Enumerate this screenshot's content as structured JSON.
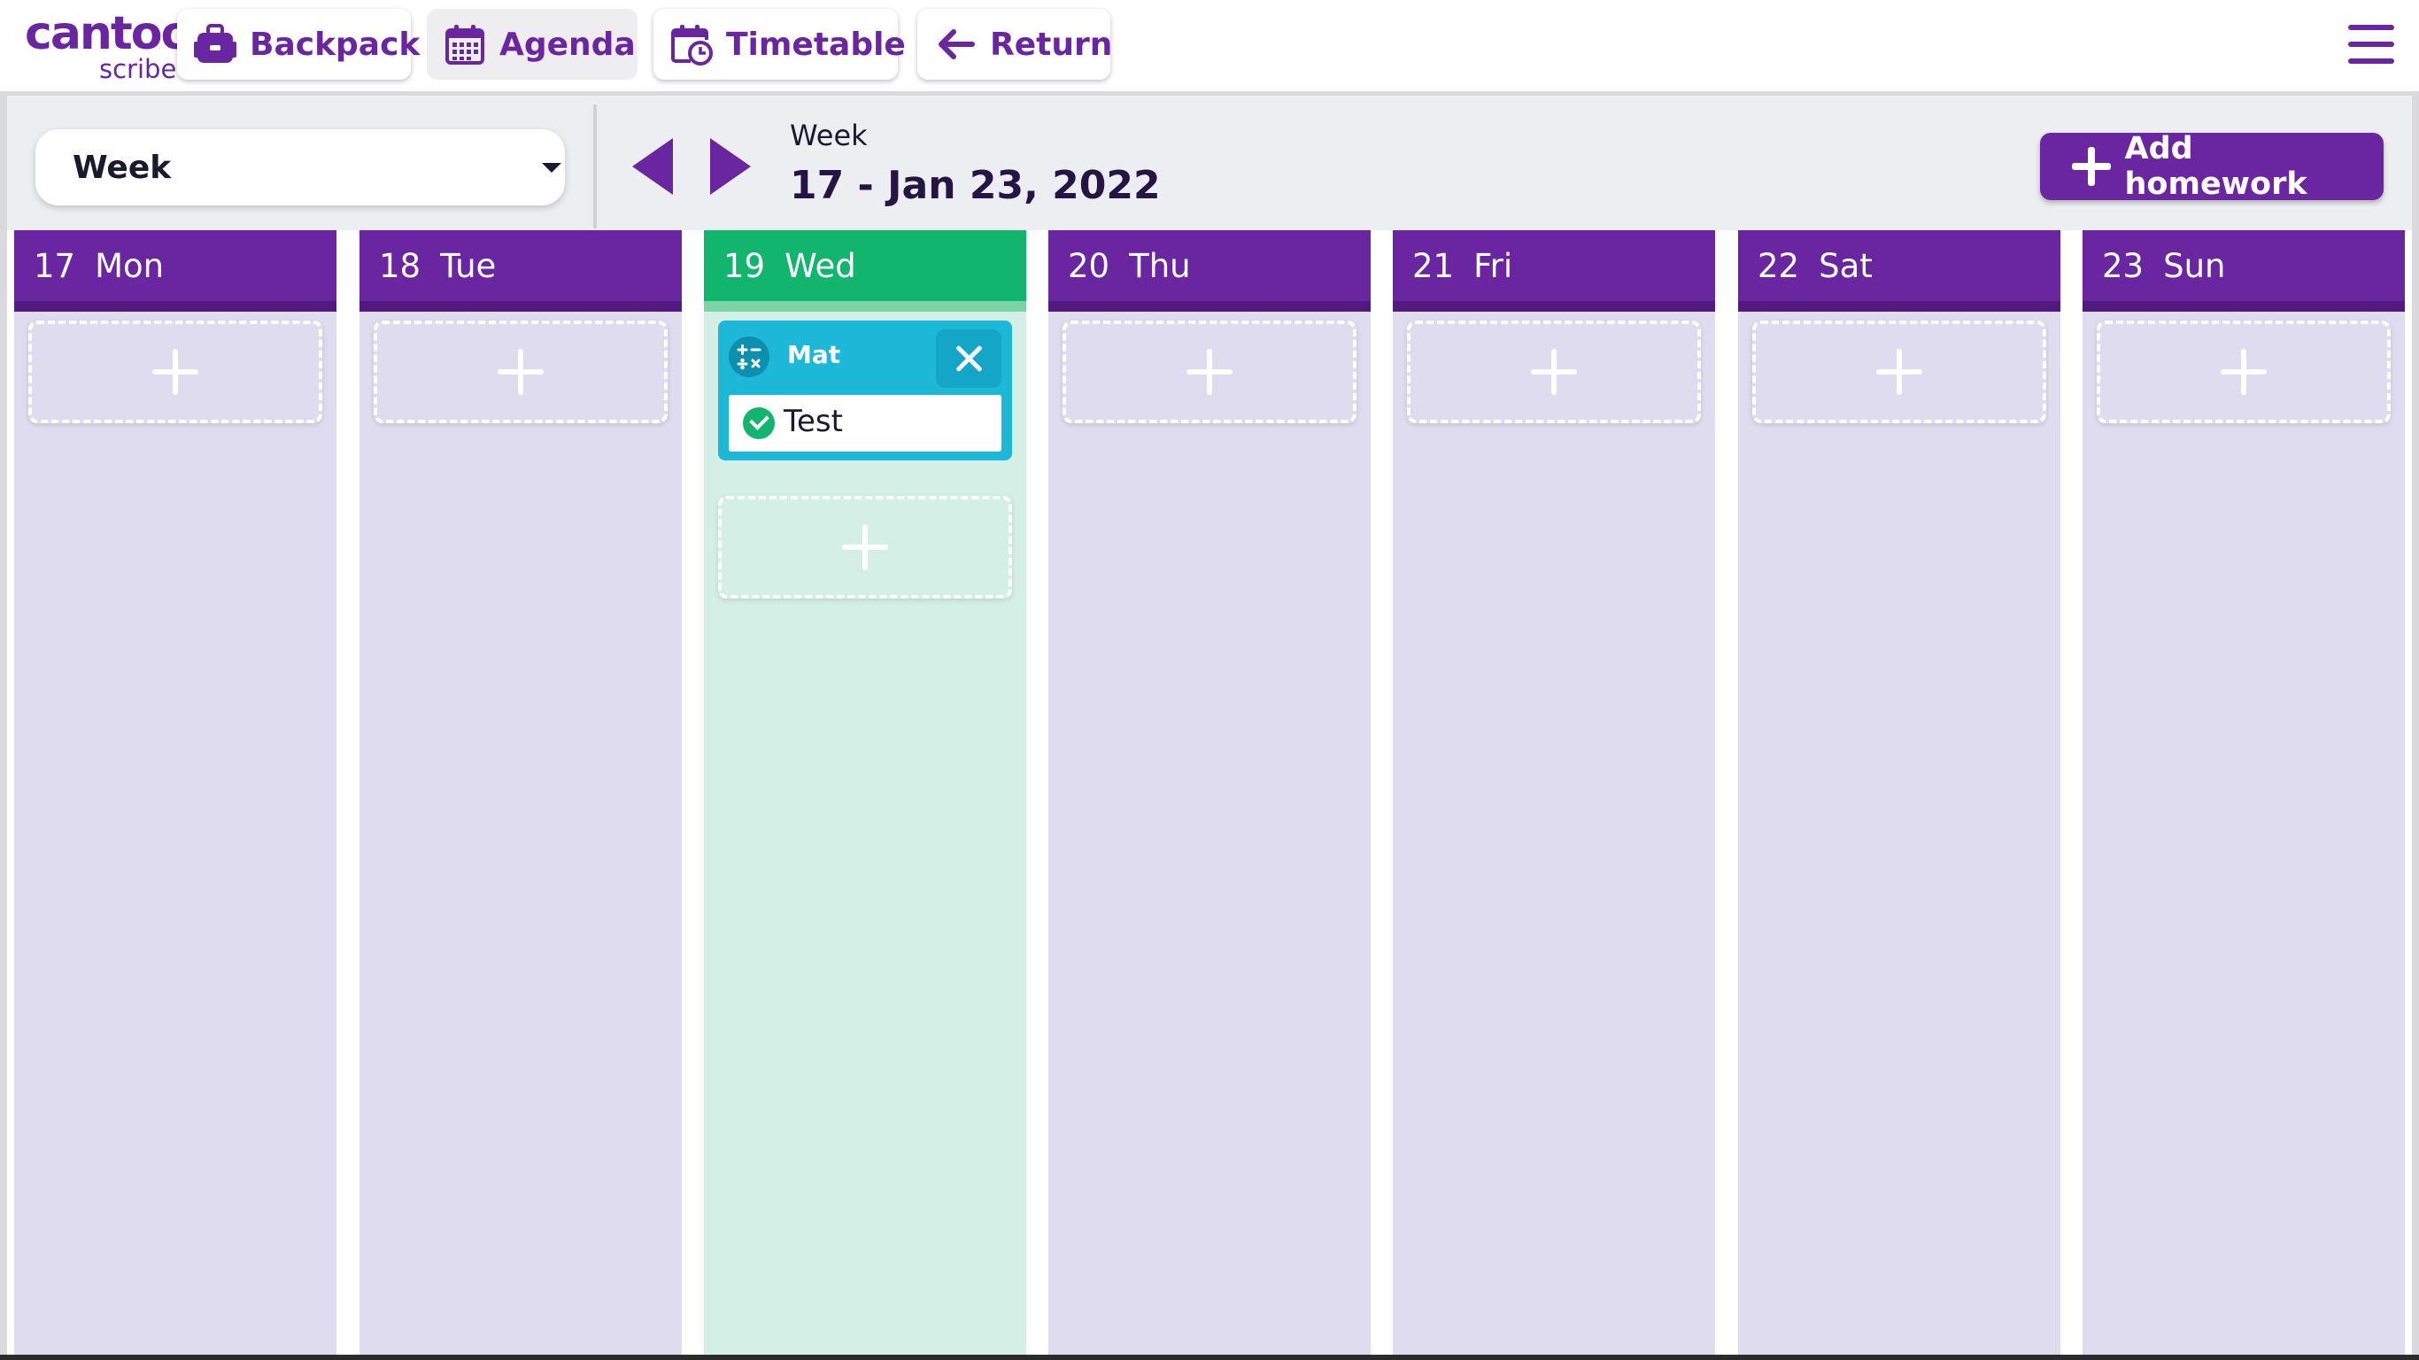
{
  "logo": {
    "main": "cantoo",
    "sub": "scribe"
  },
  "nav": {
    "backpack": "Backpack",
    "agenda": "Agenda",
    "timetable": "Timetable",
    "return": "Return"
  },
  "toolbar": {
    "view_select_value": "Week",
    "week_label": "Week",
    "week_range": "17 - Jan 23, 2022",
    "add_homework_label": "Add homework"
  },
  "days": [
    {
      "num": "17",
      "name": "Mon",
      "today": false
    },
    {
      "num": "18",
      "name": "Tue",
      "today": false
    },
    {
      "num": "19",
      "name": "Wed",
      "today": true
    },
    {
      "num": "20",
      "name": "Thu",
      "today": false
    },
    {
      "num": "21",
      "name": "Fri",
      "today": false
    },
    {
      "num": "22",
      "name": "Sat",
      "today": false
    },
    {
      "num": "23",
      "name": "Sun",
      "today": false
    }
  ],
  "homework": {
    "subject": "Mat",
    "task": "Test",
    "done": true
  },
  "colors": {
    "brand": "#6a26a0",
    "today_header": "#12b56e",
    "day_column": "#e0dcef",
    "today_column": "#d4efe6",
    "homework_card": "#1db8d8"
  },
  "icons": {
    "backpack": "backpack-icon",
    "agenda": "calendar-icon",
    "timetable": "calendar-clock-icon",
    "return": "arrow-left-icon",
    "menu": "hamburger-menu-icon",
    "subject": "math-operators-icon"
  }
}
